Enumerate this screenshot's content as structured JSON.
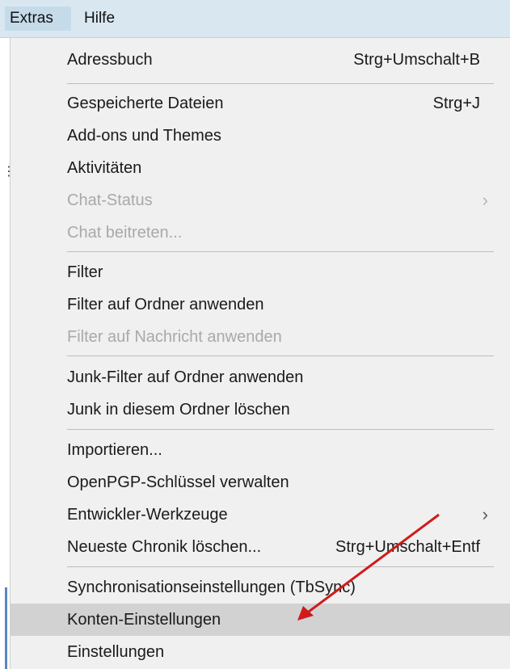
{
  "menubar": {
    "extras": "Extras",
    "hilfe": "Hilfe"
  },
  "menu": {
    "adressbuch": {
      "label": "Adressbuch",
      "shortcut": "Strg+Umschalt+B"
    },
    "gespeicherte": {
      "label": "Gespeicherte Dateien",
      "shortcut": "Strg+J"
    },
    "addons": {
      "label": "Add-ons und Themes"
    },
    "aktivitaeten": {
      "label": "Aktivitäten"
    },
    "chat_status": {
      "label": "Chat-Status",
      "submenu": "›"
    },
    "chat_beitreten": {
      "label": "Chat beitreten..."
    },
    "filter": {
      "label": "Filter"
    },
    "filter_ordner": {
      "label": "Filter auf Ordner anwenden"
    },
    "filter_nachricht": {
      "label": "Filter auf Nachricht anwenden"
    },
    "junk_filter": {
      "label": "Junk-Filter auf Ordner anwenden"
    },
    "junk_loeschen": {
      "label": "Junk in diesem Ordner löschen"
    },
    "importieren": {
      "label": "Importieren..."
    },
    "openpgp": {
      "label": "OpenPGP-Schlüssel verwalten"
    },
    "entwickler": {
      "label": "Entwickler-Werkzeuge",
      "submenu": "›"
    },
    "chronik": {
      "label": "Neueste Chronik löschen...",
      "shortcut": "Strg+Umschalt+Entf"
    },
    "sync": {
      "label": "Synchronisationseinstellungen (TbSync)"
    },
    "konten": {
      "label": "Konten-Einstellungen"
    },
    "einstellungen": {
      "label": "Einstellungen"
    }
  },
  "colors": {
    "menubar_bg": "#d9e7f1",
    "menu_bg": "#f0f0f0",
    "highlight": "#d2d2d2",
    "annotation_arrow": "#d11a1a"
  },
  "icons": {
    "submenu": "chevron-right-icon",
    "annotation": "red-arrow-icon"
  }
}
